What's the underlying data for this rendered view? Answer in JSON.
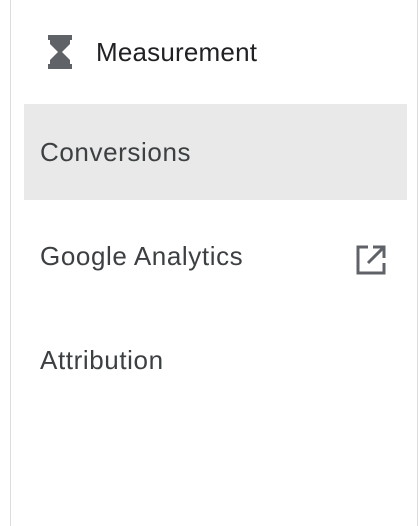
{
  "section": {
    "title": "Measurement",
    "icon": "hourglass-icon"
  },
  "nav": {
    "items": [
      {
        "label": "Conversions",
        "selected": true,
        "external": false
      },
      {
        "label": "Google Analytics",
        "selected": false,
        "external": true,
        "trailing_icon": "open-in-new-icon"
      },
      {
        "label": "Attribution",
        "selected": false,
        "external": false
      }
    ]
  },
  "colors": {
    "selected_bg": "#e8e9e8",
    "text": "#3c4043",
    "icon": "#5f6368",
    "divider": "#dadce0"
  }
}
